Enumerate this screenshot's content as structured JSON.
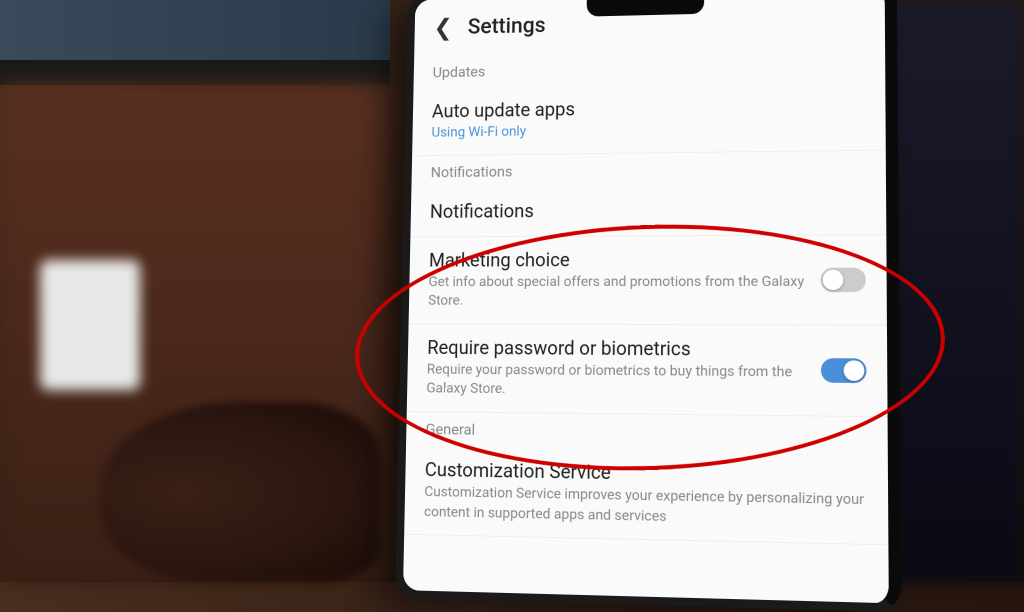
{
  "header": {
    "title": "Settings"
  },
  "sections": {
    "updates_header": "Updates",
    "auto_update": {
      "title": "Auto update apps",
      "subtitle": "Using Wi-Fi only"
    },
    "notifications_header": "Notifications",
    "notifications_item": {
      "title": "Notifications"
    },
    "marketing": {
      "title": "Marketing choice",
      "subtitle": "Get info about special offers and promotions from the Galaxy Store.",
      "enabled": false
    },
    "biometrics": {
      "title": "Require password or biometrics",
      "subtitle": "Require your password or biometrics to buy things from the Galaxy Store.",
      "enabled": true
    },
    "general_header": "General",
    "customization": {
      "title": "Customization Service",
      "subtitle": "Customization Service improves your experience by personalizing your content in supported apps and services"
    }
  }
}
